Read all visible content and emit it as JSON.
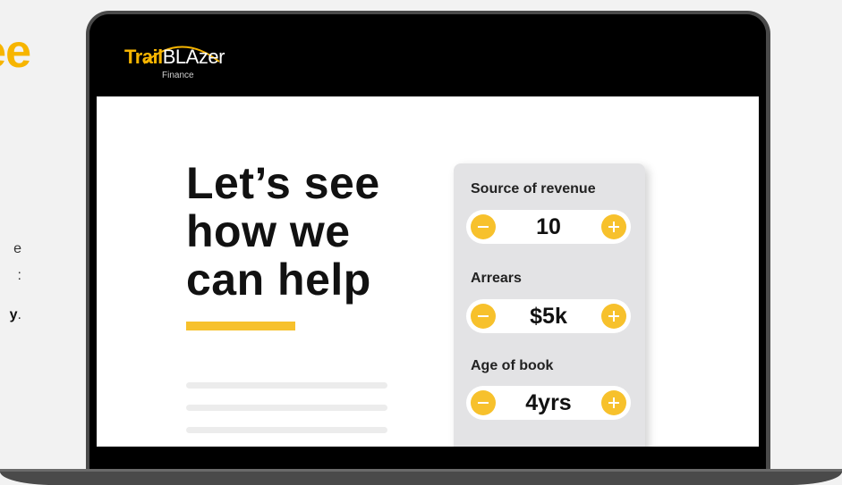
{
  "side": {
    "heading_fragment": "ee",
    "line1": "e",
    "line2": ":",
    "line3_bold": "y",
    "line3_tail": "."
  },
  "logo": {
    "trail": "Trail",
    "blazer": "BLAzer",
    "sub": "Finance"
  },
  "hero": {
    "line1": "Let’s see",
    "line2": "how we",
    "line3": "can help"
  },
  "calculator": {
    "fields": [
      {
        "label": "Source of revenue",
        "value": "10"
      },
      {
        "label": "Arrears",
        "value": "$5k"
      },
      {
        "label": "Age of book",
        "value": "4yrs"
      }
    ]
  },
  "colors": {
    "accent": "#f7c12c",
    "brand_yellow": "#f7b500",
    "panel": "#e3e3e5",
    "frame": "#4a4a4a"
  },
  "icons": {
    "minus": "minus-circle-icon",
    "plus": "plus-circle-icon"
  }
}
